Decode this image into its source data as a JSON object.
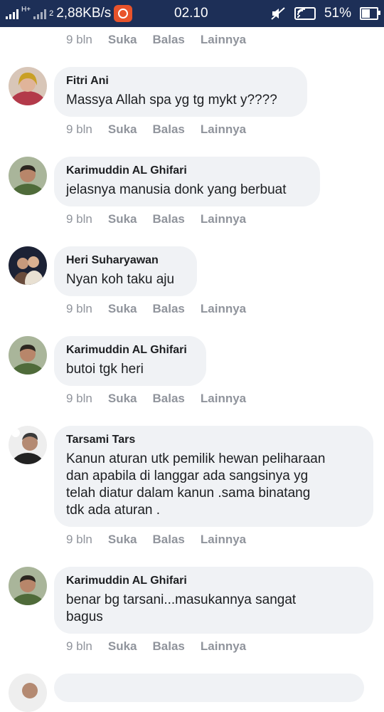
{
  "statusbar": {
    "network_type": "H+",
    "sim_slot": "2",
    "speed": "2,88KB/s",
    "time": "02.10",
    "battery": "51%",
    "battery_level": 0.51,
    "icons": [
      "signal-icon",
      "screen-record-icon",
      "mute-icon",
      "wifi-icon",
      "battery-icon"
    ]
  },
  "top_actions": {
    "time": "9 bln",
    "like": "Suka",
    "reply": "Balas",
    "more": "Lainnya"
  },
  "comments": [
    {
      "author": "Fitri Ani",
      "text": "Massya Allah spa yg tg mykt y????",
      "time": "9 bln",
      "like": "Suka",
      "reply": "Balas",
      "more": "Lainnya"
    },
    {
      "author": "Karimuddin AL Ghifari",
      "text": "jelasnya manusia donk yang berbuat",
      "time": "9 bln",
      "like": "Suka",
      "reply": "Balas",
      "more": "Lainnya"
    },
    {
      "author": "Heri Suharyawan",
      "text": "Nyan koh taku aju",
      "time": "9 bln",
      "like": "Suka",
      "reply": "Balas",
      "more": "Lainnya"
    },
    {
      "author": "Karimuddin AL Ghifari",
      "text": "butoi tgk heri",
      "time": "9 bln",
      "like": "Suka",
      "reply": "Balas",
      "more": "Lainnya"
    },
    {
      "author": "Tarsami Tars",
      "text": "Kanun aturan utk pemilik hewan peliharaan\ndan apabila di langgar ada sangsinya yg\ntelah diatur dalam kanun .sama binatang\ntdk ada aturan .",
      "time": "9 bln",
      "like": "Suka",
      "reply": "Balas",
      "more": "Lainnya"
    },
    {
      "author": "Karimuddin AL Ghifari",
      "text": "benar bg tarsani...masukannya sangat\nbagus",
      "time": "9 bln",
      "like": "Suka",
      "reply": "Balas",
      "more": "Lainnya"
    }
  ],
  "colors": {
    "statusbar_bg": "#1d2f57",
    "bubble_bg": "#f0f2f5",
    "action_text": "#90949c",
    "body_text": "#1c1e21"
  }
}
